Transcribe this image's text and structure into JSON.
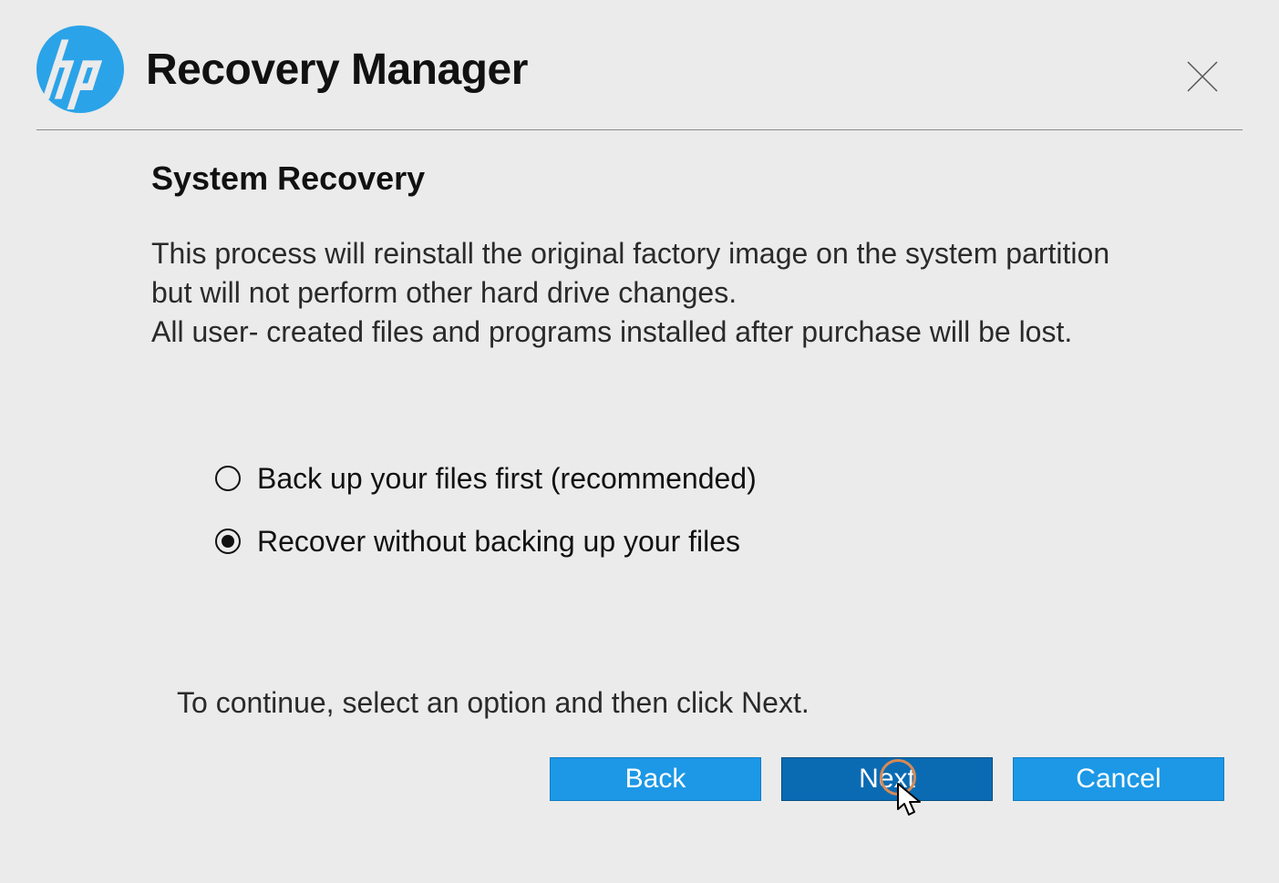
{
  "header": {
    "app_title": "Recovery Manager"
  },
  "page": {
    "section_title": "System Recovery",
    "description_line1": "This process will reinstall the original factory image on the system partition but will not perform other hard drive changes.",
    "description_line2": "All user- created files and programs installed after purchase will be lost.",
    "instruction": "To continue, select an option and then click Next."
  },
  "options": [
    {
      "label": "Back up your files first (recommended)",
      "selected": false
    },
    {
      "label": "Recover without backing up your files",
      "selected": true
    }
  ],
  "buttons": {
    "back": "Back",
    "next": "Next",
    "cancel": "Cancel"
  },
  "colors": {
    "accent": "#1c98e6",
    "accent_dark": "#0a6bb3",
    "hp_blue": "#2ba3e8"
  }
}
